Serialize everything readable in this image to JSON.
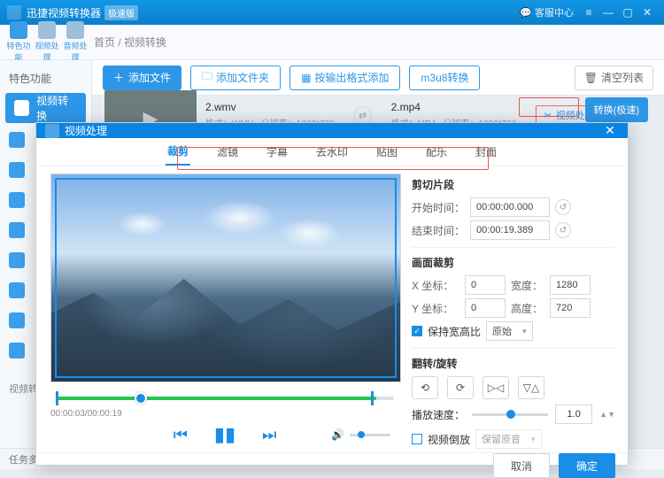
{
  "titlebar": {
    "app": "迅捷视频转换器",
    "edition": "极速版",
    "help": "客服中心"
  },
  "nav": {
    "featured": "特色功能",
    "video": "视频处理",
    "audio": "音频处理"
  },
  "breadcrumb": "首页 / 视频转换",
  "toolbar": {
    "add_file": "添加文件",
    "add_folder": "添加文件夹",
    "add_by_fmt": "按输出格式添加",
    "m3u8": "m3u8转换",
    "clear": "清空列表"
  },
  "sidebar": {
    "head": "特色功能",
    "item_active": "视频转换",
    "more": "视频转..."
  },
  "task_pill": "任务多线",
  "file": {
    "src": {
      "name": "2.wmv",
      "fmt_k": "格式：",
      "fmt_v": "WMV",
      "res_k": "分辨率：",
      "res_v": "1280*720"
    },
    "dst": {
      "name": "2.mp4",
      "fmt_k": "格式：",
      "fmt_v": "MP4",
      "res_k": "分辨率：",
      "res_v": "1280*720"
    },
    "proc": "视频处理",
    "convert": "转换(极速)"
  },
  "modal": {
    "title": "视频处理",
    "tabs": [
      "裁剪",
      "滤镜",
      "字幕",
      "去水印",
      "贴图",
      "配乐",
      "封面"
    ],
    "active_tab": 0,
    "time": {
      "section": "剪切片段",
      "start_k": "开始时间：",
      "start_v": "00:00:00.000",
      "end_k": "结束时间：",
      "end_v": "00:00:19.389"
    },
    "crop": {
      "section": "画面裁剪",
      "x_k": "X 坐标：",
      "x_v": "0",
      "w_k": "宽度：",
      "w_v": "1280",
      "y_k": "Y 坐标：",
      "y_v": "0",
      "h_k": "高度：",
      "h_v": "720",
      "keep_ratio": "保持宽高比",
      "ratio_option": "原始"
    },
    "rotate": {
      "section": "翻转/旋转"
    },
    "speed": {
      "label": "播放速度：",
      "value": "1.0"
    },
    "reverse": {
      "label": "视频倒放",
      "keep_audio": "保留原音"
    },
    "timecode": "00:00:03/00:00:19",
    "footer": {
      "cancel": "取消",
      "ok": "确定"
    }
  }
}
